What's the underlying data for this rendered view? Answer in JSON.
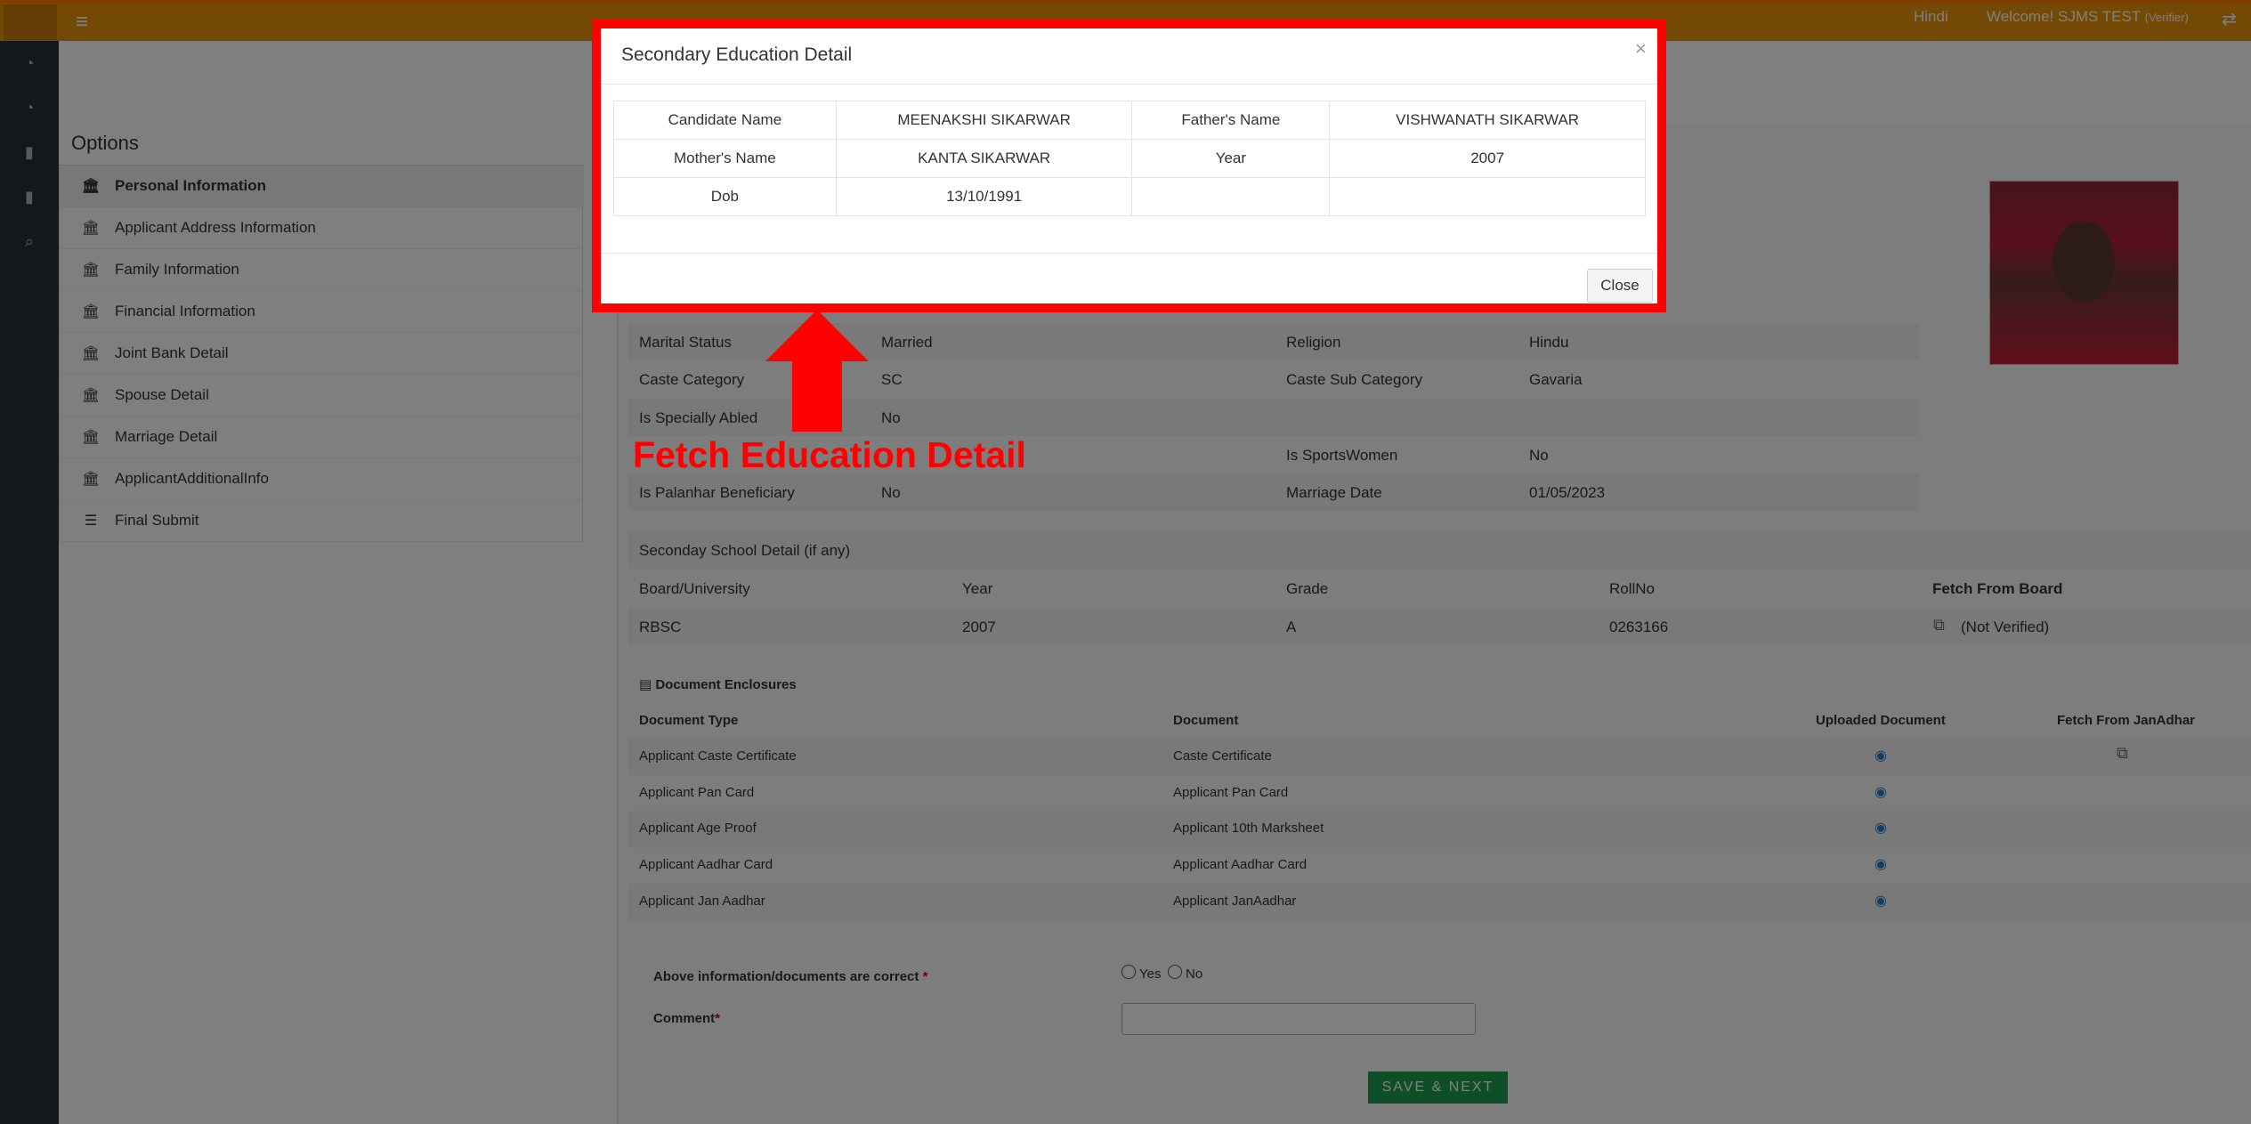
{
  "topbar": {
    "language": "Hindi",
    "welcome": "Welcome! SJMS TEST",
    "role": "(Verifier)"
  },
  "options": {
    "title": "Options",
    "items": [
      {
        "label": "Personal Information",
        "icon": "bank-icon",
        "active": true
      },
      {
        "label": "Applicant Address Information",
        "icon": "bank-icon"
      },
      {
        "label": "Family Information",
        "icon": "bank-icon"
      },
      {
        "label": "Financial Information",
        "icon": "bank-icon"
      },
      {
        "label": "Joint Bank Detail",
        "icon": "bank-icon"
      },
      {
        "label": "Spouse Detail",
        "icon": "bank-icon"
      },
      {
        "label": "Marriage Detail",
        "icon": "bank-icon"
      },
      {
        "label": "ApplicantAdditionalInfo",
        "icon": "bank-icon"
      },
      {
        "label": "Final Submit",
        "icon": "list-icon"
      }
    ]
  },
  "personal": {
    "marital_status_label": "Marital Status",
    "marital_status": "Married",
    "religion_label": "Religion",
    "religion": "Hindu",
    "caste_category_label": "Caste Category",
    "caste_category": "SC",
    "caste_sub_category_label": "Caste Sub Category",
    "caste_sub_category": "Gavaria",
    "specially_abled_label": "Is Specially Abled",
    "specially_abled": "No",
    "sportswomen_label": "Is SportsWomen",
    "sportswomen": "No",
    "palanhar_label": "Is Palanhar Beneficiary",
    "palanhar": "No",
    "marriage_date_label": "Marriage Date",
    "marriage_date": "01/05/2023"
  },
  "school": {
    "section_title": "Seconday School Detail (if any)",
    "headers": [
      "Board/University",
      "Year",
      "Grade",
      "RollNo",
      "Fetch From Board"
    ],
    "row": {
      "board": "RBSC",
      "year": "2007",
      "grade": "A",
      "rollno": "0263166",
      "status": "(Not Verified)"
    }
  },
  "documents": {
    "section_title": "Document Enclosures",
    "headers": [
      "Document Type",
      "Document",
      "Uploaded Document",
      "Fetch From JanAdhar"
    ],
    "rows": [
      {
        "type": "Applicant Caste Certificate",
        "document": "Caste Certificate"
      },
      {
        "type": "Applicant Pan Card",
        "document": "Applicant Pan Card"
      },
      {
        "type": "Applicant Age Proof",
        "document": "Applicant 10th Marksheet"
      },
      {
        "type": "Applicant Aadhar Card",
        "document": "Applicant Aadhar Card"
      },
      {
        "type": "Applicant Jan Aadhar",
        "document": "Applicant JanAadhar"
      }
    ]
  },
  "verify": {
    "question": "Above information/documents are correct",
    "yes": "Yes",
    "no": "No",
    "comment_label": "Comment",
    "required": "*",
    "save_label": "SAVE & NEXT"
  },
  "modal": {
    "title": "Secondary Education Detail",
    "close_x": "×",
    "close_label": "Close",
    "rows": [
      [
        "Candidate Name",
        "MEENAKSHI SIKARWAR",
        "Father's Name",
        "VISHWANATH SIKARWAR"
      ],
      [
        "Mother's Name",
        "KANTA SIKARWAR",
        "Year",
        "2007"
      ],
      [
        "Dob",
        "13/10/1991",
        "",
        ""
      ]
    ]
  },
  "annotation": {
    "text": "Fetch Education Detail",
    "color": "#ff0000"
  }
}
